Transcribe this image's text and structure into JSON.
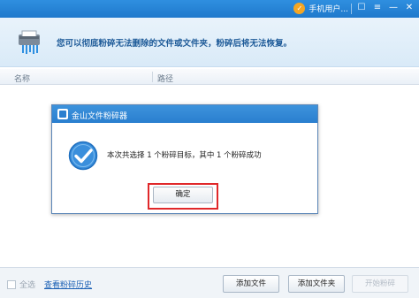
{
  "titlebar": {
    "user_label": "手机用户...",
    "avatar_glyph": "✓",
    "icons": [
      "feedback-icon",
      "menu-icon",
      "minimize-icon",
      "close-icon"
    ],
    "icon_glyphs": [
      "☐",
      "≡",
      "—",
      "✕"
    ]
  },
  "banner": {
    "message": "您可以彻底粉碎无法删除的文件或文件夹，粉碎后将无法恢复。"
  },
  "table": {
    "headers": [
      "名称",
      "路径"
    ]
  },
  "dialog": {
    "title": "金山文件粉碎器",
    "message": "本次共选择 1 个粉碎目标，其中 1 个粉碎成功",
    "ok_label": "确定"
  },
  "footer": {
    "select_all_label": "全选",
    "history_link": "查看粉碎历史",
    "add_file_label": "添加文件",
    "add_folder_label": "添加文件夹",
    "start_label": "开始粉碎"
  },
  "colors": {
    "titlebar": "#2a84d6",
    "highlight": "#e0282a",
    "link": "#1a5fb4"
  }
}
